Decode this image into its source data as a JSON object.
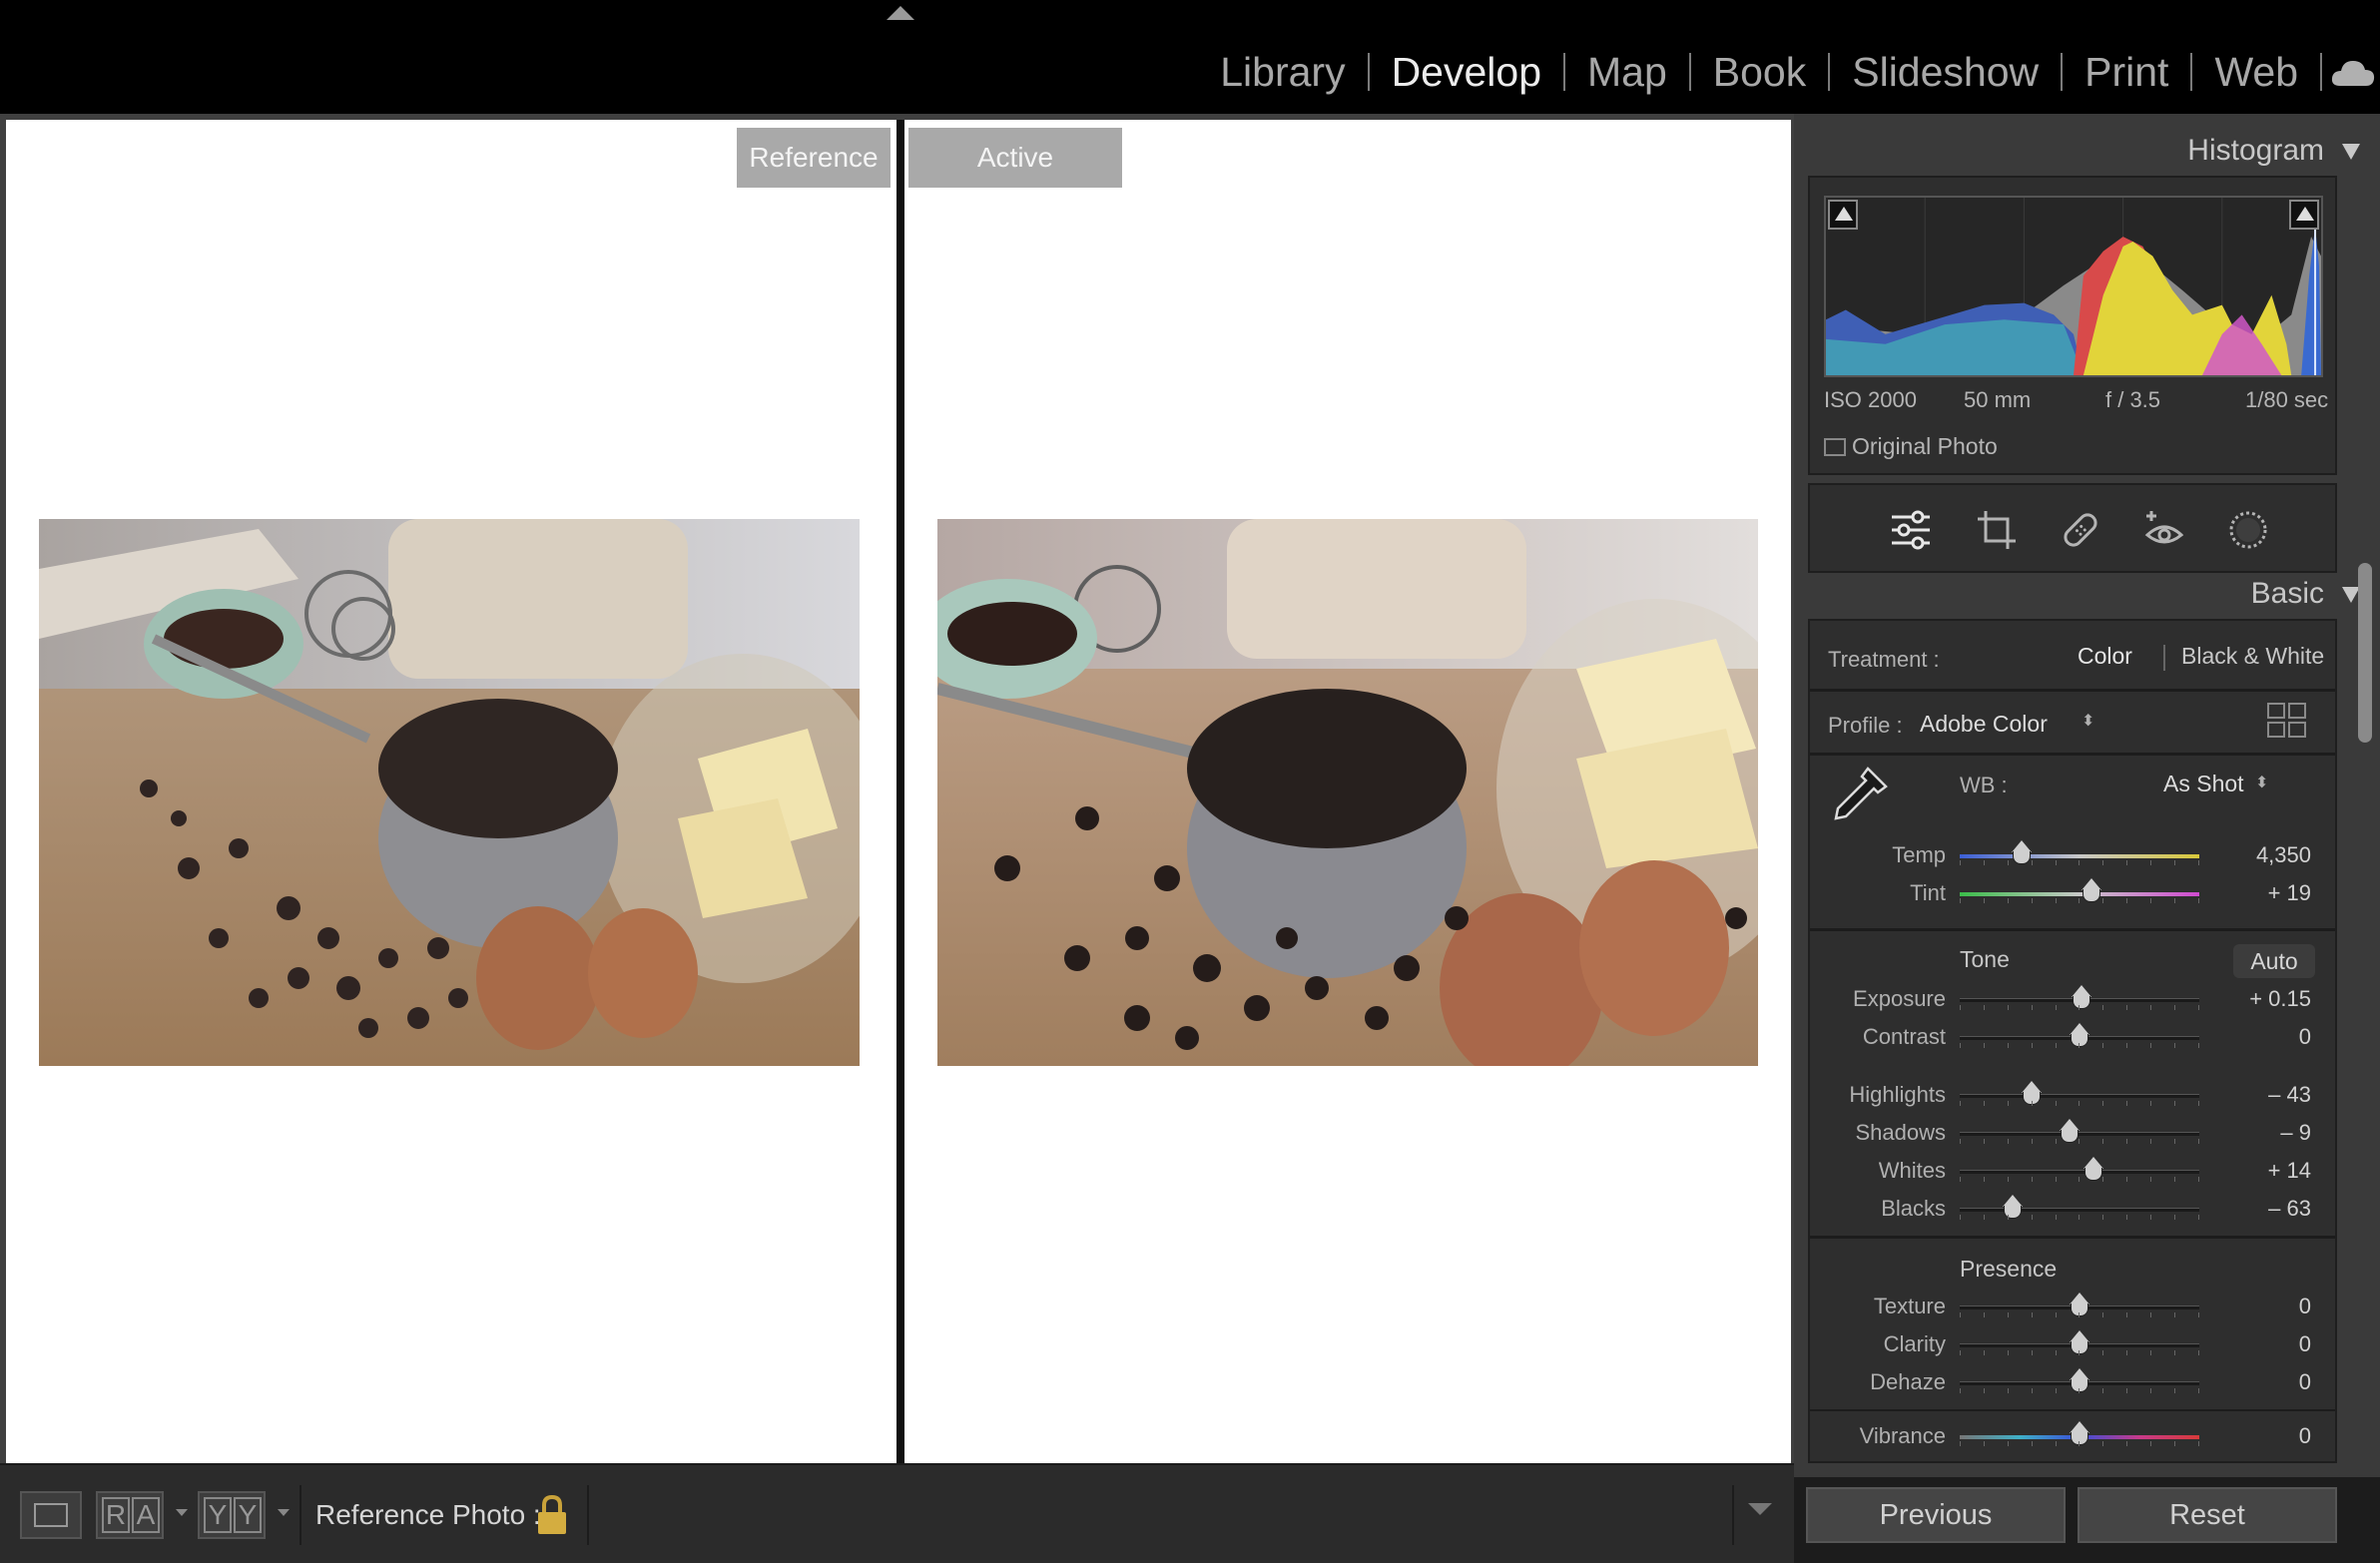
{
  "modules": [
    "Library",
    "Develop",
    "Map",
    "Book",
    "Slideshow",
    "Print",
    "Web"
  ],
  "active_module": "Develop",
  "view": {
    "reference_label": "Reference",
    "active_label": "Active"
  },
  "toolbar": {
    "ra_glyph_1": "R",
    "ra_glyph_2": "A",
    "yy_glyph_1": "Y",
    "yy_glyph_2": "Y",
    "reference_photo_label": "Reference Photo :"
  },
  "histogram": {
    "title": "Histogram",
    "iso": "ISO 2000",
    "focal": "50 mm",
    "aperture": "f / 3.5",
    "shutter": "1/80 sec",
    "original_photo": "Original Photo"
  },
  "basic": {
    "title": "Basic",
    "treatment_label": "Treatment :",
    "treatment_color": "Color",
    "treatment_bw": "Black & White",
    "profile_label": "Profile :",
    "profile_value": "Adobe Color",
    "wb_label": "WB :",
    "wb_value": "As Shot",
    "tone_title": "Tone",
    "auto_label": "Auto",
    "presence_title": "Presence",
    "sliders": {
      "temp": {
        "label": "Temp",
        "value": "4,350",
        "pos": 0.26
      },
      "tint": {
        "label": "Tint",
        "value": "+ 19",
        "pos": 0.55
      },
      "exposure": {
        "label": "Exposure",
        "value": "+ 0.15",
        "pos": 0.51
      },
      "contrast": {
        "label": "Contrast",
        "value": "0",
        "pos": 0.5
      },
      "highlights": {
        "label": "Highlights",
        "value": "– 43",
        "pos": 0.3
      },
      "shadows": {
        "label": "Shadows",
        "value": "– 9",
        "pos": 0.46
      },
      "whites": {
        "label": "Whites",
        "value": "+ 14",
        "pos": 0.56
      },
      "blacks": {
        "label": "Blacks",
        "value": "– 63",
        "pos": 0.22
      },
      "texture": {
        "label": "Texture",
        "value": "0",
        "pos": 0.5
      },
      "clarity": {
        "label": "Clarity",
        "value": "0",
        "pos": 0.5
      },
      "dehaze": {
        "label": "Dehaze",
        "value": "0",
        "pos": 0.5
      },
      "vibrance": {
        "label": "Vibrance",
        "value": "0",
        "pos": 0.5
      }
    }
  },
  "buttons": {
    "previous": "Previous",
    "reset": "Reset"
  },
  "icons": [
    "cloud-icon",
    "lock-icon",
    "eyedropper-icon",
    "grid-icon",
    "sliders-icon",
    "crop-icon",
    "healing-icon",
    "redeye-icon",
    "mask-icon"
  ],
  "colors": {
    "panel_bg": "#3a3a3a",
    "section_bg": "#2e2e2e",
    "active_module": "#ececec",
    "inactive_module": "#a8a8a8"
  }
}
